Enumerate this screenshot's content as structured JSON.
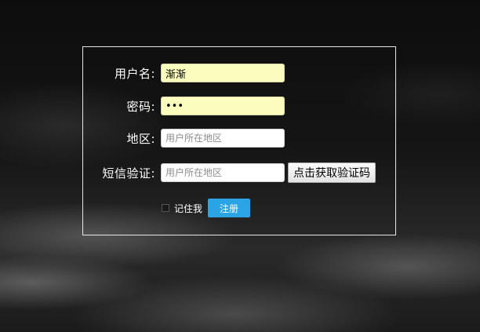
{
  "form": {
    "username": {
      "label": "用户名:",
      "value": "渐渐"
    },
    "password": {
      "label": "密码:",
      "value": "•••"
    },
    "region": {
      "label": "地区:",
      "value": "",
      "placeholder": "用户所在地区"
    },
    "sms": {
      "label": "短信验证:",
      "value": "",
      "placeholder": "用户所在地区",
      "button_label": "点击获取验证码"
    },
    "remember_label": "记住我",
    "remember_checked": false,
    "register_label": "注册"
  },
  "colors": {
    "filled_input_bg": "#fbfdbf",
    "register_button_bg": "#2aa4e4",
    "panel_border": "#e6e6e6"
  }
}
